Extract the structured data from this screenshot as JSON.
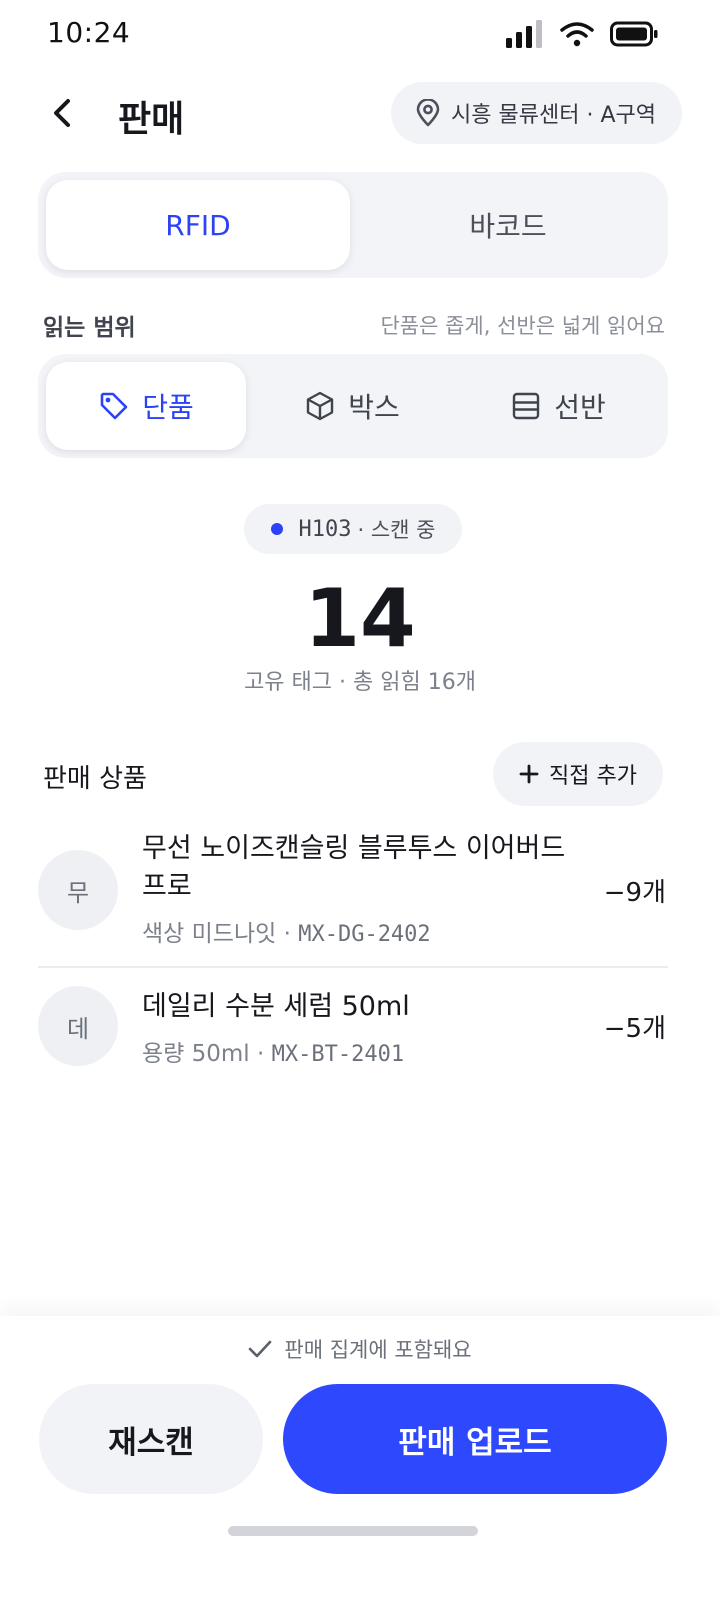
{
  "status": {
    "time": "10:24"
  },
  "header": {
    "title": "판매",
    "location": "시흥 물류센터 · A구역"
  },
  "mode_tabs": [
    {
      "label": "RFID",
      "active": true
    },
    {
      "label": "바코드",
      "active": false
    }
  ],
  "range": {
    "label": "읽는 범위",
    "hint": "단품은 좁게, 선반은 넓게 읽어요",
    "options": [
      {
        "label": "단품",
        "icon": "tag-icon",
        "active": true
      },
      {
        "label": "박스",
        "icon": "box-icon",
        "active": false
      },
      {
        "label": "선반",
        "icon": "shelf-icon",
        "active": false
      }
    ]
  },
  "scan": {
    "device": "H103",
    "status": "· 스캔 중",
    "count": "14",
    "caption": "고유 태그 · 총 읽힘 16개"
  },
  "products": {
    "title": "판매 상품",
    "add_label": "직접 추가",
    "items": [
      {
        "avatar": "무",
        "name": "무선 노이즈캔슬링 블루투스 이어버드 프로",
        "option": "색상 미드나잇 · ",
        "sku": "MX-DG-2402",
        "qty": "−9개"
      },
      {
        "avatar": "데",
        "name": "데일리 수분 세럼 50ml",
        "option": "용량 50ml · ",
        "sku": "MX-BT-2401",
        "qty": "−5개"
      }
    ]
  },
  "footer": {
    "note": "판매 집계에 포함돼요",
    "rescan_label": "재스캔",
    "upload_label": "판매 업로드"
  },
  "colors": {
    "accent": "#2E48FD",
    "surface": "#F3F4F8"
  }
}
